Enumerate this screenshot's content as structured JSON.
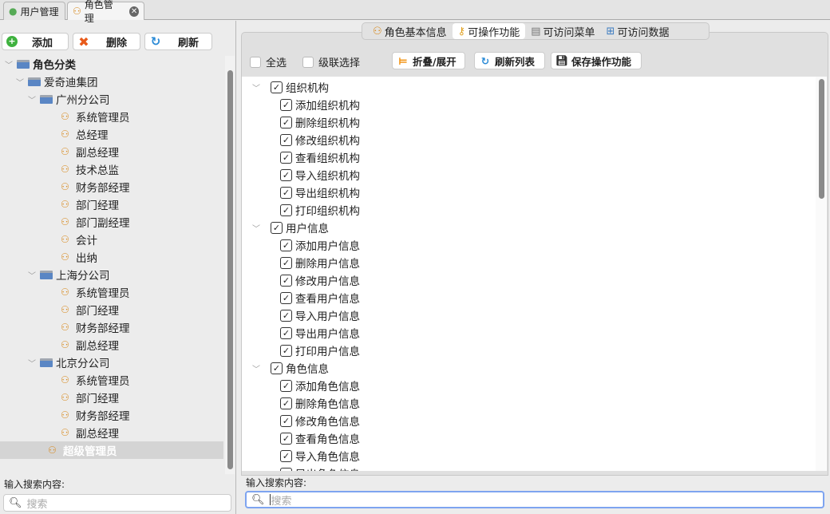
{
  "top_tabs": [
    {
      "label": "用户管理",
      "icon": "user-icon"
    },
    {
      "label": "角色管理",
      "icon": "role-icon",
      "active": true
    }
  ],
  "left": {
    "toolbar": {
      "add": "添加",
      "delete": "删除",
      "refresh": "刷新"
    },
    "tree": [
      {
        "label": "角色分类",
        "level": 0,
        "type": "folder"
      },
      {
        "label": "爱奇迪集团",
        "level": 1,
        "type": "folder"
      },
      {
        "label": "广州分公司",
        "level": 2,
        "type": "folder"
      },
      {
        "label": "系统管理员",
        "level": 3,
        "type": "role"
      },
      {
        "label": "总经理",
        "level": 3,
        "type": "role"
      },
      {
        "label": "副总经理",
        "level": 3,
        "type": "role"
      },
      {
        "label": "技术总监",
        "level": 3,
        "type": "role"
      },
      {
        "label": "财务部经理",
        "level": 3,
        "type": "role"
      },
      {
        "label": "部门经理",
        "level": 3,
        "type": "role"
      },
      {
        "label": "部门副经理",
        "level": 3,
        "type": "role"
      },
      {
        "label": "会计",
        "level": 3,
        "type": "role"
      },
      {
        "label": "出纳",
        "level": 3,
        "type": "role"
      },
      {
        "label": "上海分公司",
        "level": 2,
        "type": "folder"
      },
      {
        "label": "系统管理员",
        "level": 3,
        "type": "role"
      },
      {
        "label": "部门经理",
        "level": 3,
        "type": "role"
      },
      {
        "label": "财务部经理",
        "level": 3,
        "type": "role"
      },
      {
        "label": "副总经理",
        "level": 3,
        "type": "role"
      },
      {
        "label": "北京分公司",
        "level": 2,
        "type": "folder"
      },
      {
        "label": "系统管理员",
        "level": 3,
        "type": "role"
      },
      {
        "label": "部门经理",
        "level": 3,
        "type": "role"
      },
      {
        "label": "财务部经理",
        "level": 3,
        "type": "role"
      },
      {
        "label": "副总经理",
        "level": 3,
        "type": "role"
      },
      {
        "label": "超级管理员",
        "level": 2,
        "type": "role",
        "selected": true
      }
    ],
    "search_label": "输入搜索内容:",
    "search_placeholder": "搜索"
  },
  "right": {
    "tabs": [
      {
        "label": "角色基本信息",
        "icon": "role-icon"
      },
      {
        "label": "可操作功能",
        "icon": "key-icon",
        "active": true
      },
      {
        "label": "可访问菜单",
        "icon": "menu-icon"
      },
      {
        "label": "可访问数据",
        "icon": "data-icon"
      }
    ],
    "select_all": "全选",
    "cascade": "级联选择",
    "collapse": "折叠/展开",
    "refresh_list": "刷新列表",
    "save": "保存操作功能",
    "groups": [
      {
        "label": "组织机构",
        "items": [
          "添加组织机构",
          "删除组织机构",
          "修改组织机构",
          "查看组织机构",
          "导入组织机构",
          "导出组织机构",
          "打印组织机构"
        ]
      },
      {
        "label": "用户信息",
        "items": [
          "添加用户信息",
          "删除用户信息",
          "修改用户信息",
          "查看用户信息",
          "导入用户信息",
          "导出用户信息",
          "打印用户信息"
        ]
      },
      {
        "label": "角色信息",
        "items": [
          "添加角色信息",
          "删除角色信息",
          "修改角色信息",
          "查看角色信息",
          "导入角色信息",
          "导出角色信息"
        ]
      }
    ],
    "search_label": "输入搜索内容:",
    "search_placeholder": "搜索"
  }
}
